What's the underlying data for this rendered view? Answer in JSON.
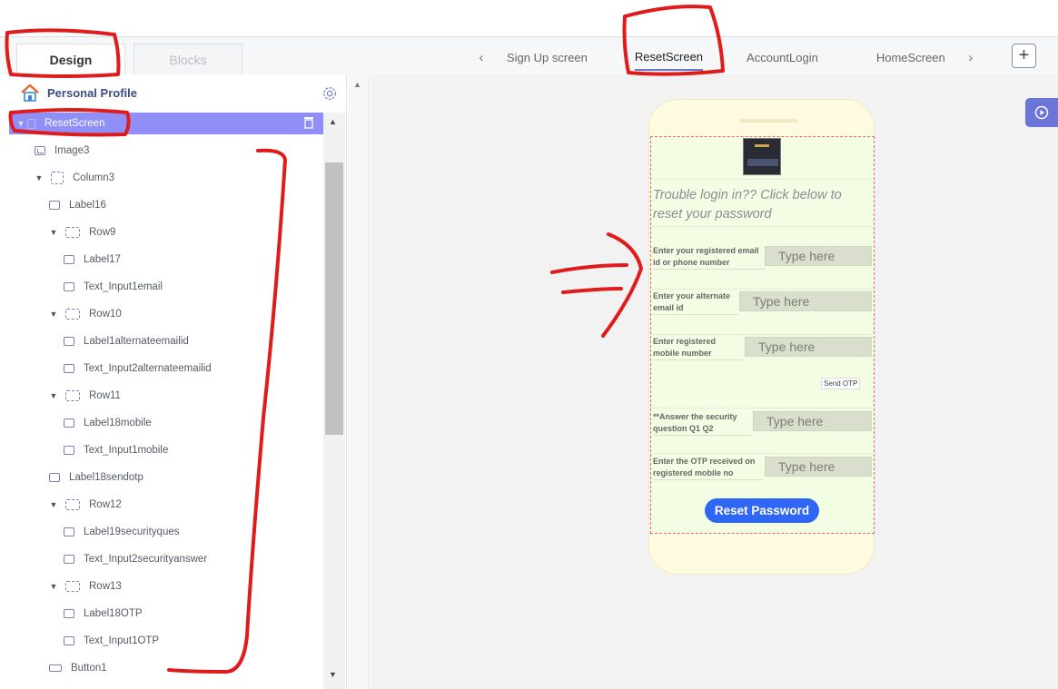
{
  "mode_tabs": {
    "design": "Design",
    "blocks": "Blocks"
  },
  "screen_tabs": [
    "Sign Up screen",
    "ResetScreen",
    "AccountLogin",
    "HomeScreen"
  ],
  "project": {
    "name": "Personal Profile"
  },
  "tree": [
    {
      "label": "ResetScreen",
      "icon": "page"
    },
    {
      "label": "Image3",
      "icon": "img"
    },
    {
      "label": "Column3",
      "icon": "col"
    },
    {
      "label": "Label16",
      "icon": "label"
    },
    {
      "label": "Row9",
      "icon": "row"
    },
    {
      "label": "Label17",
      "icon": "label"
    },
    {
      "label": "Text_Input1email",
      "icon": "txt"
    },
    {
      "label": "Row10",
      "icon": "row"
    },
    {
      "label": "Label1alternateemailid",
      "icon": "label"
    },
    {
      "label": "Text_Input2alternateemailid",
      "icon": "txt"
    },
    {
      "label": "Row11",
      "icon": "row"
    },
    {
      "label": "Label18mobile",
      "icon": "label"
    },
    {
      "label": "Text_Input1mobile",
      "icon": "txt"
    },
    {
      "label": "Label18sendotp",
      "icon": "label"
    },
    {
      "label": "Row12",
      "icon": "row"
    },
    {
      "label": "Label19securityques",
      "icon": "label"
    },
    {
      "label": "Text_Input2securityanswer",
      "icon": "txt"
    },
    {
      "label": "Row13",
      "icon": "row"
    },
    {
      "label": "Label18OTP",
      "icon": "label"
    },
    {
      "label": "Text_Input1OTP",
      "icon": "txt"
    },
    {
      "label": "Button1",
      "icon": "btn"
    }
  ],
  "phone": {
    "heading": "Trouble login in?? Click below to reset your password",
    "fields": [
      {
        "label": "Enter your registered email id or phone number",
        "placeholder": "Type here"
      },
      {
        "label": "Enter your alternate email id",
        "placeholder": "Type here"
      },
      {
        "label": "Enter registered mobile number",
        "placeholder": "Type here"
      },
      {
        "label": "**Answer the security question Q1 Q2",
        "placeholder": "Type here"
      },
      {
        "label": "Enter the OTP received on registered mobile no",
        "placeholder": "Type here"
      }
    ],
    "send_otp": "Send OTP",
    "reset_button": "Reset Password"
  },
  "colors": {
    "accent": "#6b76d8",
    "selection": "#8f8ff7",
    "button": "#2f66f3",
    "annotation": "#e01b1b"
  }
}
